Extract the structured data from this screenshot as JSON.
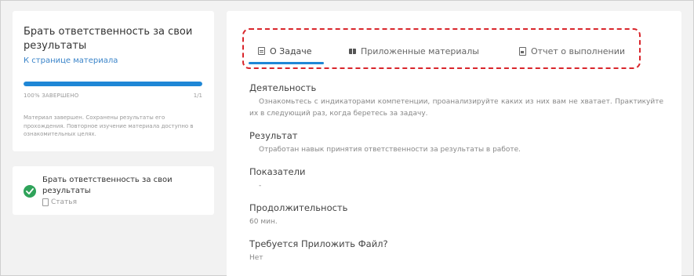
{
  "sidebar": {
    "course_title": "Брать ответственность за свои результаты",
    "back_link": "К странице материала",
    "progress": {
      "fraction": 1.0,
      "status": "100% ЗАВЕРШЕНО",
      "count": "1/1",
      "fill_color": "#1f87d6"
    },
    "completion_note": "Материал завершен. Сохранены результаты его прохождения. Повторное изучение материала доступно в ознакомительных целях.",
    "items": [
      {
        "title": "Брать ответственность за свои результаты",
        "type_label": "Статья",
        "status_icon": "check-circle-icon",
        "status_color": "#2fa35a"
      }
    ]
  },
  "tabs": [
    {
      "label": "О Задаче",
      "icon": "list-icon",
      "active": true
    },
    {
      "label": "Приложенные материалы",
      "icon": "book-icon",
      "active": false
    },
    {
      "label": "Отчет о выполнении",
      "icon": "report-icon",
      "active": false
    }
  ],
  "accent_color": "#1f87d6",
  "task": {
    "activity_label": "Деятельность",
    "activity_text": "Ознакомьтесь с индикаторами компетенции, проанализируйте каких из них вам не хватает. Практикуйте их в следующий раз, когда беретесь за задачу.",
    "result_label": "Результат",
    "result_text": "Отработан навык принятия ответственности за результаты в работе.",
    "indicators_label": "Показатели",
    "indicators_text": "-",
    "duration_label": "Продолжительность",
    "duration_text": "60 мин.",
    "file_required_label": "Требуется Приложить Файл?",
    "file_required_text": "Нет"
  }
}
